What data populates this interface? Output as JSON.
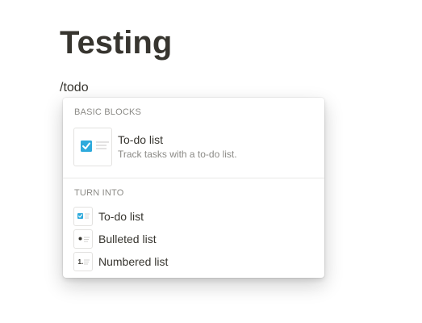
{
  "page": {
    "title": "Testing",
    "editor_text": "/todo"
  },
  "menu": {
    "basic_blocks_label": "BASIC BLOCKS",
    "basic_item": {
      "title": "To-do list",
      "description": "Track tasks with a to-do list.",
      "icon": "todo-checkbox-icon"
    },
    "turn_into_label": "TURN INTO",
    "turn_into_items": [
      {
        "label": "To-do list",
        "icon": "todo-checkbox-icon"
      },
      {
        "label": "Bulleted list",
        "icon": "bullet-list-icon"
      },
      {
        "label": "Numbered list",
        "icon": "numbered-list-icon"
      }
    ]
  },
  "colors": {
    "checkbox_accent": "#2eaadc",
    "text": "#37352f",
    "muted": "#8c8b87"
  }
}
